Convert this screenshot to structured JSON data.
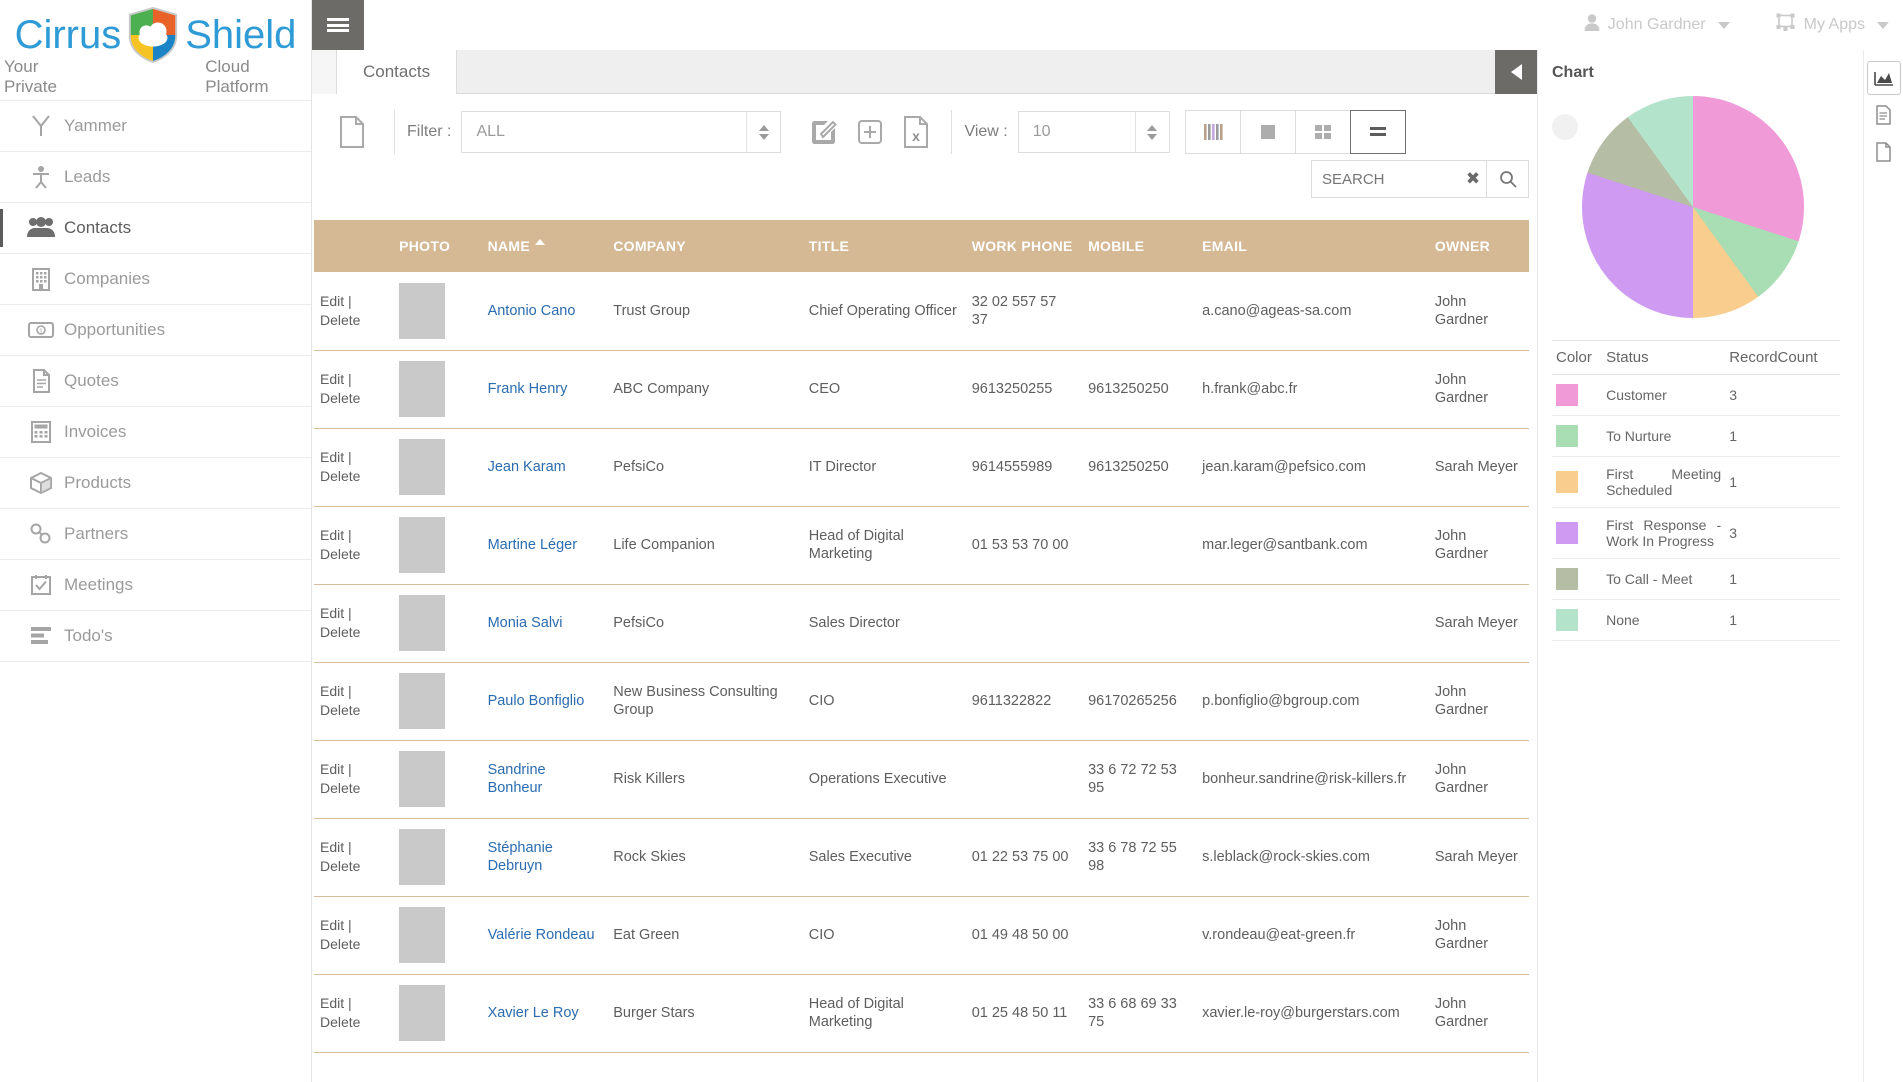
{
  "brand": {
    "name_part1": "Cirrus",
    "name_part2": "Shield",
    "tagline_left": "Your Private",
    "tagline_right": "Cloud Platform"
  },
  "topbar": {
    "user": "John Gardner",
    "apps": "My Apps"
  },
  "sidebar": {
    "items": [
      {
        "label": "Yammer",
        "icon": "yammer-icon",
        "active": false
      },
      {
        "label": "Leads",
        "icon": "lead-person-icon",
        "active": false
      },
      {
        "label": "Contacts",
        "icon": "contacts-group-icon",
        "active": true
      },
      {
        "label": "Companies",
        "icon": "building-icon",
        "active": false
      },
      {
        "label": "Opportunities",
        "icon": "banknote-icon",
        "active": false
      },
      {
        "label": "Quotes",
        "icon": "document-icon",
        "active": false
      },
      {
        "label": "Invoices",
        "icon": "calculator-icon",
        "active": false
      },
      {
        "label": "Products",
        "icon": "box-icon",
        "active": false
      },
      {
        "label": "Partners",
        "icon": "link-chain-icon",
        "active": false
      },
      {
        "label": "Meetings",
        "icon": "calendar-check-icon",
        "active": false
      },
      {
        "label": "Todo's",
        "icon": "todo-list-icon",
        "active": false
      }
    ]
  },
  "tabs": {
    "active": "Contacts"
  },
  "toolbar": {
    "filter_label": "Filter :",
    "filter_value": "ALL",
    "view_label": "View :",
    "view_value": "10",
    "search_placeholder": "SEARCH",
    "search_value": ""
  },
  "table": {
    "columns": [
      "PHOTO",
      "NAME",
      "COMPANY",
      "TITLE",
      "WORK PHONE",
      "MOBILE",
      "EMAIL",
      "OWNER"
    ],
    "sort_column": "NAME",
    "sort_direction": "asc",
    "row_actions": {
      "edit": "Edit",
      "sep": "|",
      "delete": "Delete"
    },
    "rows": [
      {
        "name": "Antonio Cano",
        "company": "Trust Group",
        "title": "Chief Operating Officer",
        "work_phone": "32 02 557 57 37",
        "mobile": "",
        "email": "a.cano@ageas-sa.com",
        "owner": "John Gardner"
      },
      {
        "name": "Frank Henry",
        "company": "ABC Company",
        "title": "CEO",
        "work_phone": "9613250255",
        "mobile": "9613250250",
        "email": "h.frank@abc.fr",
        "owner": "John Gardner"
      },
      {
        "name": "Jean Karam",
        "company": "PefsiCo",
        "title": "IT Director",
        "work_phone": "9614555989",
        "mobile": "9613250250",
        "email": "jean.karam@pefsico.com",
        "owner": "Sarah Meyer"
      },
      {
        "name": "Martine Léger",
        "company": "Life Companion",
        "title": "Head of Digital Marketing",
        "work_phone": "01 53 53 70 00",
        "mobile": "",
        "email": "mar.leger@santbank.com",
        "owner": "John Gardner"
      },
      {
        "name": "Monia Salvi",
        "company": "PefsiCo",
        "title": "Sales Director",
        "work_phone": "",
        "mobile": "",
        "email": "",
        "owner": "Sarah Meyer"
      },
      {
        "name": "Paulo Bonfiglio",
        "company": "New Business Consulting Group",
        "title": "CIO",
        "work_phone": "9611322822",
        "mobile": "96170265256",
        "email": "p.bonfiglio@bgroup.com",
        "owner": "John Gardner"
      },
      {
        "name": "Sandrine Bonheur",
        "company": "Risk Killers",
        "title": "Operations Executive",
        "work_phone": "",
        "mobile": "33 6 72 72 53 95",
        "email": "bonheur.sandrine@risk-killers.fr",
        "owner": "John Gardner"
      },
      {
        "name": "Stéphanie Debruyn",
        "company": "Rock Skies",
        "title": "Sales Executive",
        "work_phone": "01 22 53 75 00",
        "mobile": "33 6 78 72 55 98",
        "email": "s.leblack@rock-skies.com",
        "owner": "Sarah Meyer"
      },
      {
        "name": "Valérie Rondeau",
        "company": "Eat Green",
        "title": "CIO",
        "work_phone": "01 49 48 50 00",
        "mobile": "",
        "email": "v.rondeau@eat-green.fr",
        "owner": "John Gardner"
      },
      {
        "name": "Xavier Le Roy",
        "company": "Burger Stars",
        "title": "Head of Digital Marketing",
        "work_phone": "01 25 48 50 11",
        "mobile": "33 6 68 69 33 75",
        "email": "xavier.le-roy@burgerstars.com",
        "owner": "John Gardner"
      }
    ]
  },
  "chart_panel": {
    "title": "Chart",
    "legend_headers": [
      "Color",
      "Status",
      "RecordCount"
    ]
  },
  "chart_data": {
    "type": "pie",
    "title": "Chart",
    "categories": [
      "Customer",
      "To Nurture",
      "First Meeting Scheduled",
      "First Response - Work In Progress",
      "To Call - Meet",
      "None"
    ],
    "values": [
      3,
      1,
      1,
      3,
      1,
      1
    ],
    "colors": [
      "#f09ad8",
      "#a9ddb4",
      "#f8cd8d",
      "#cf9bf2",
      "#b5bda4",
      "#b3e3cb"
    ],
    "total": 10,
    "legend_position": "below",
    "xlabel": "",
    "ylabel": ""
  },
  "rail": {
    "buttons": [
      {
        "icon": "chart-area-icon",
        "active": true
      },
      {
        "icon": "report-doc-icon",
        "active": false
      },
      {
        "icon": "blank-doc-icon",
        "active": false
      }
    ]
  }
}
